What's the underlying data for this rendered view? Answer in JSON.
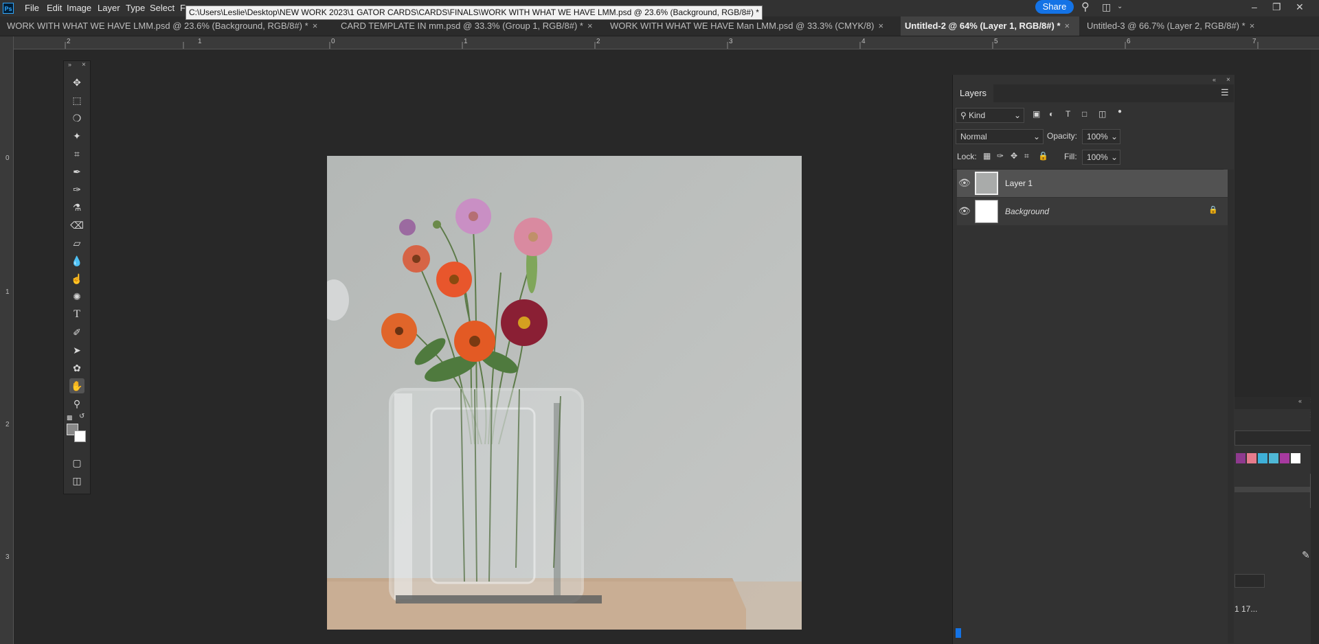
{
  "app": {
    "logo": "Ps"
  },
  "menu": [
    "File",
    "Edit",
    "Image",
    "Layer",
    "Type",
    "Select",
    "F"
  ],
  "tooltip": "C:\\Users\\Leslie\\Desktop\\NEW WORK 2023\\1 GATOR CARDS\\CARDS\\FINALS\\WORK WITH WHAT WE HAVE LMM.psd @ 23.6% (Background, RGB/8#) *",
  "share_label": "Share",
  "tabs": [
    {
      "label": "WORK WITH WHAT WE HAVE LMM.psd @ 23.6% (Background, RGB/8#) *",
      "active": false
    },
    {
      "label": "CARD TEMPLATE IN mm.psd @ 33.3% (Group 1, RGB/8#) *",
      "active": false
    },
    {
      "label": "WORK WITH WHAT WE HAVE Man LMM.psd @ 33.3% (CMYK/8)",
      "active": false
    },
    {
      "label": "Untitled-2 @ 64% (Layer 1, RGB/8#) *",
      "active": true
    },
    {
      "label": "Untitled-3 @ 66.7% (Layer 2, RGB/8#) *",
      "active": false
    }
  ],
  "ruler_top": [
    "2",
    "1",
    "0",
    "1",
    "2",
    "3",
    "4",
    "5",
    "6",
    "7"
  ],
  "ruler_left": [
    "0",
    "1",
    "2",
    "3"
  ],
  "tools": [
    "move-icon",
    "rect-marquee-icon",
    "lasso-icon",
    "magic-wand-icon",
    "crop-icon",
    "eyedropper-icon",
    "brush-icon",
    "clone-stamp-icon",
    "eraser-icon",
    "paint-bucket-icon",
    "blur-icon",
    "smudge-icon",
    "sponge-icon",
    "type-icon",
    "pen-icon",
    "path-select-icon",
    "custom-shape-icon",
    "hand-icon",
    "zoom-icon"
  ],
  "layers": {
    "tab": "Layers",
    "filter_kind": "Kind",
    "blend_mode": "Normal",
    "opacity_label": "Opacity:",
    "opacity": "100%",
    "lock_label": "Lock:",
    "fill_label": "Fill:",
    "fill": "100%",
    "items": [
      {
        "name": "Layer 1",
        "selected": true,
        "locked": false
      },
      {
        "name": "Background",
        "selected": false,
        "locked": true
      }
    ]
  },
  "side_panel": {
    "partial_text": "1  17..."
  },
  "colors": {
    "accent": "#1473e6",
    "swatches": [
      "#8e3a8e",
      "#e67b8c",
      "#3eb0d8",
      "#4fb8d6",
      "#a73aa0",
      "#ffffff"
    ]
  }
}
